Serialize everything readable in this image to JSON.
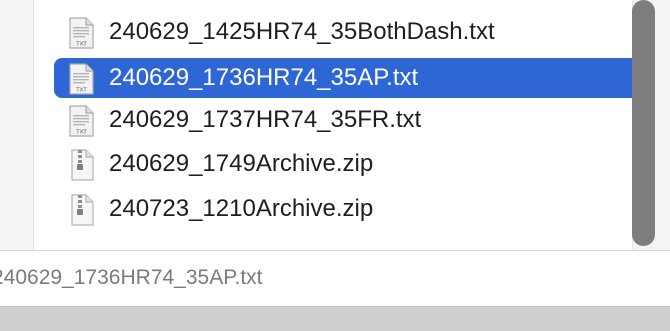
{
  "file_list": {
    "items": [
      {
        "name": "240629_1425HR74_35BothDash.txt",
        "icon": "txt-file-icon",
        "selected": false
      },
      {
        "name": "240629_1736HR74_35AP.txt",
        "icon": "txt-file-icon",
        "selected": true
      },
      {
        "name": "240629_1737HR74_35FR.txt",
        "icon": "txt-file-icon",
        "selected": false
      },
      {
        "name": "240629_1749Archive.zip",
        "icon": "zip-file-icon",
        "selected": false
      },
      {
        "name": "240723_1210Archive.zip",
        "icon": "zip-file-icon",
        "selected": false
      }
    ]
  },
  "status_bar": {
    "path": "240629_1736HR74_35AP.txt"
  },
  "colors": {
    "selection": "#2e66d6",
    "selected_text": "#ffffff",
    "text": "#1e1e1e",
    "status_text": "#7b7b7b"
  }
}
